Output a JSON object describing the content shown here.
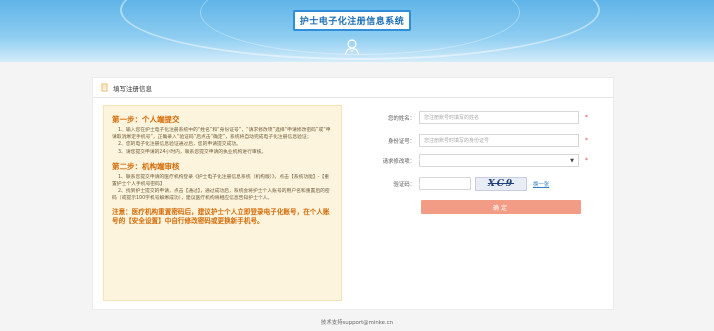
{
  "header": {
    "title": "护士电子化注册信息系统"
  },
  "card": {
    "title": "填写注册信息"
  },
  "instructions": {
    "step1_title": "第一步：个人端提交",
    "step1_lines": [
      "1、输入您在护士电子化注册系统中的“姓名”和“身份证号”，“请求修改项”选择“申请修改密码”或“申请取消绑定手机号”，正确录入“验证码”后点击“确定”，系统将自动完成电子化注册信息验证；",
      "2、您的电子化注册信息验证通过后，您的申请提交成功。",
      "3、请您提交申请的24小时内，联系您提交申请的执业机构进行审核。"
    ],
    "step2_title": "第二步：机构端审核",
    "step2_lines": [
      "1、联系您提交申请的医疗机构登录《护士电子化注册信息系统（机构版）》，点击【系统功能】-【重置护士个人手机号密码】",
      "2、找到护士提交的申请，点击【通过】，通过成功后，系统会将护士个人账号的用户名和重置后的密码（或提示100字机号解绑成功），建议医疗机构将相应信息告知护士个人。"
    ],
    "notice": "注意：医疗机构重置密码后，建议护士个人立即登录电子化账号，在个人账号的【安全设置】中自行修改密码或更换新手机号。"
  },
  "form": {
    "name_label": "您的姓名：",
    "name_placeholder": "您注册账号时填写的姓名",
    "id_label": "身份证号：",
    "id_placeholder": "您注册账号时填写的身份证号",
    "request_label": "请求修改项：",
    "request_value": "",
    "captcha_label": "验证码：",
    "captcha_text": "XC9",
    "refresh_label": "换一张",
    "required_mark": "*",
    "submit_label": "确定"
  },
  "footer": {
    "text": "技术支持support@minke.cn"
  },
  "colors": {
    "header": "#5fb4e8",
    "accent": "#d46b08",
    "button": "#f29b85",
    "panel": "#fdf4dd"
  }
}
